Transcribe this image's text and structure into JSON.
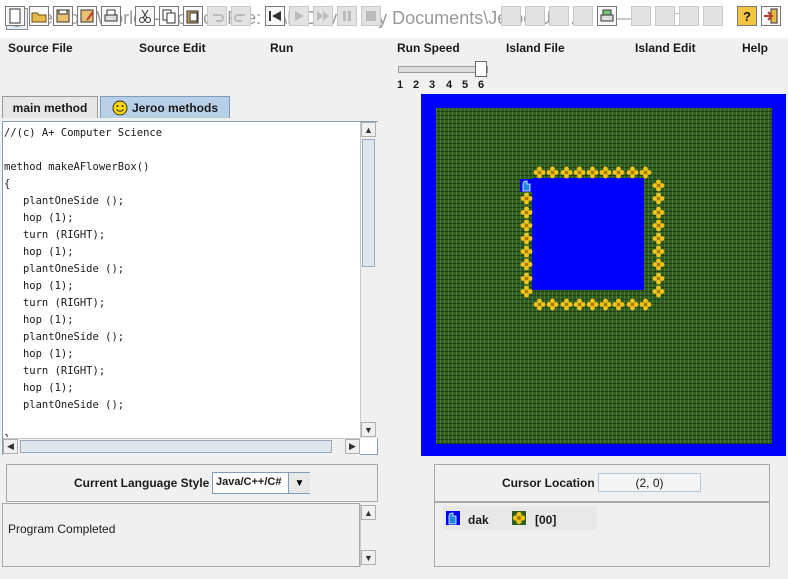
{
  "window": {
    "title": "Jeroo's World -- Source File: Z:\\H Drive - My Documents\\Jeroo Uni..."
  },
  "menu": [
    "Source File",
    "Source Edit",
    "Run",
    "Run Speed",
    "Island File",
    "Island Edit",
    "Help"
  ],
  "toolbar": {
    "file_icons": [
      "new-file-icon",
      "open-folder-icon",
      "save-icon",
      "save-as-icon",
      "print-icon"
    ],
    "edit_icons": [
      "cut-icon",
      "copy-icon",
      "paste-icon",
      "undo-icon",
      "redo-icon"
    ],
    "run_icons": [
      "reset-icon",
      "run-icon",
      "step-icon",
      "pause-icon",
      "stop-icon"
    ],
    "island_icons": [
      "new-island-icon",
      "open-island-icon",
      "save-island-icon",
      "save-island-as-icon",
      "print-island-icon"
    ],
    "island_edit_icons": [
      "clear-icon",
      "grid-icon",
      "island-icon",
      "water-icon"
    ],
    "right_icons": [
      "help-icon",
      "exit-icon"
    ],
    "speed_labels": [
      "1",
      "2",
      "3",
      "4",
      "5",
      "6"
    ],
    "speed_value": 6
  },
  "tabs": [
    {
      "label": "main method",
      "active": false
    },
    {
      "label": "Jeroo methods",
      "active": true,
      "icon": "smiley-icon"
    }
  ],
  "code_lines": [
    "//(c) A+ Computer Science",
    "",
    "method makeAFlowerBox()",
    "{",
    "   plantOneSide ();",
    "   hop (1);",
    "   turn (RIGHT);",
    "   hop (1);",
    "   plantOneSide ();",
    "   hop (1);",
    "   turn (RIGHT);",
    "   hop (1);",
    "   plantOneSide ();",
    "   hop (1);",
    "   turn (RIGHT);",
    "   hop (1);",
    "   plantOneSide ();",
    "",
    "}"
  ],
  "language": {
    "label": "Current Language Style",
    "value": "Java/C++/C#"
  },
  "status_message": "Program Completed",
  "cursor": {
    "label": "Cursor Location",
    "value": "(2, 0)"
  },
  "roster": {
    "jeroo_name": "dak",
    "flower_count": "[00]"
  },
  "colors": {
    "water": "#0000ff",
    "grass": "#2f5e1e",
    "flower": "#f0c419",
    "jeroo": "#1565c0"
  }
}
